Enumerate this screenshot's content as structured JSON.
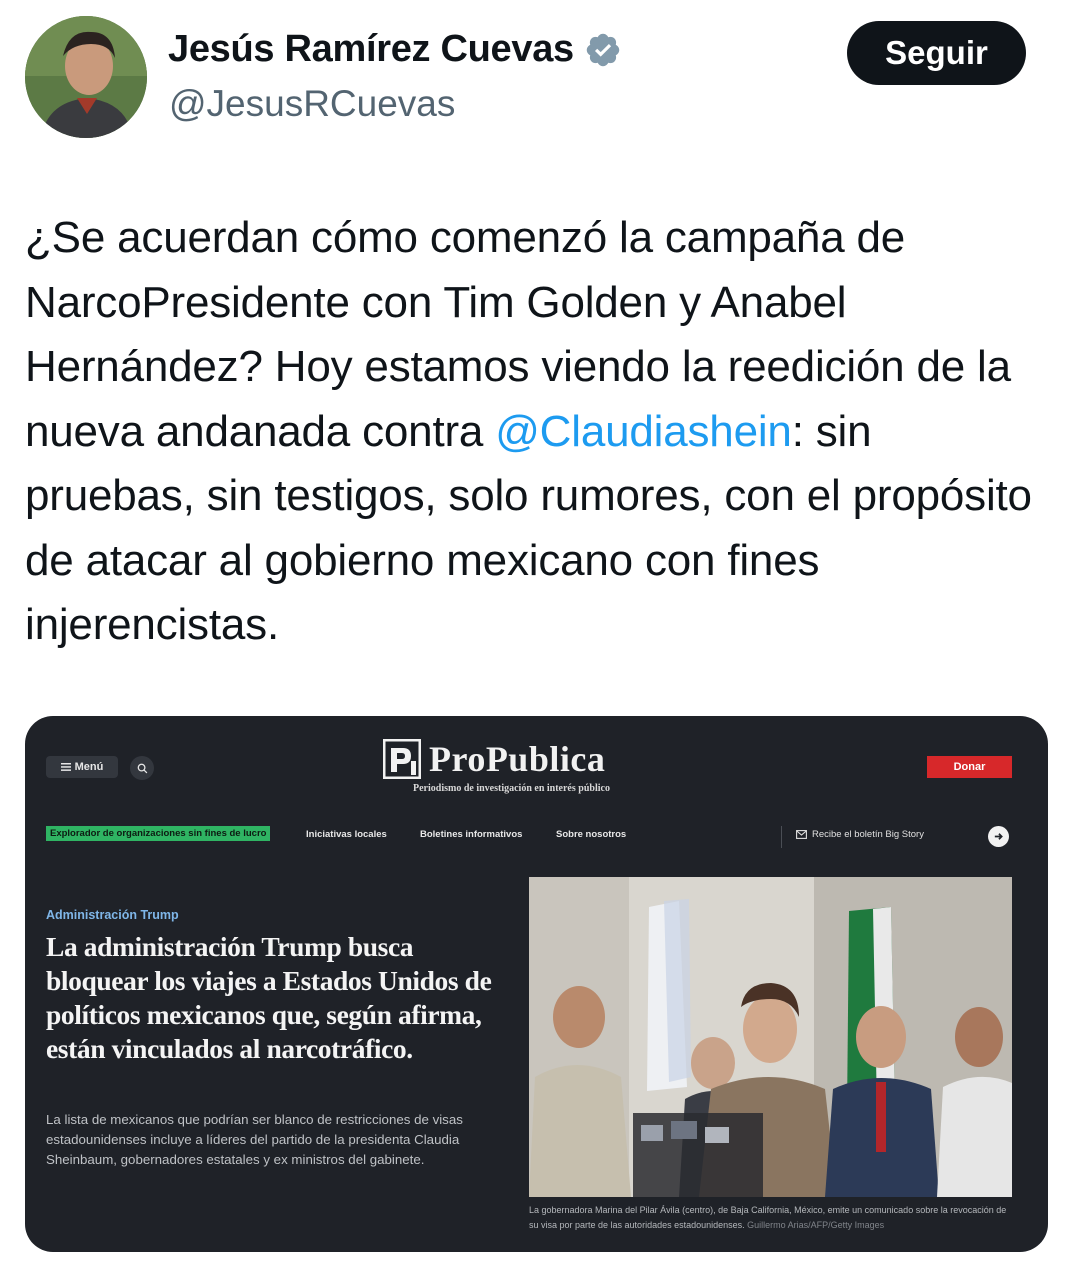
{
  "tweet": {
    "author_name": "Jesús Ramírez Cuevas",
    "handle": "@JesusRCuevas",
    "follow_label": "Seguir",
    "verified_icon": "verified-badge-icon",
    "text_part1": "¿Se acuerdan cómo comenzó la campaña de NarcoPresidente con Tim Golden y Anabel Hernández? Hoy estamos viendo la reedición de la nueva andanada contra ",
    "mention": "@Claudiashein",
    "text_part2": ": sin pruebas, sin testigos, solo rumores, con el propósito de atacar al gobierno mexicano con fines injerencistas.",
    "colors": {
      "text": "#0f1419",
      "secondary": "#536471",
      "link": "#1d9bf0",
      "verified": "#829aab"
    }
  },
  "embedded_page": {
    "menu_label": "Menú",
    "logo_text": "ProPublica",
    "tagline": "Periodismo de investigación en interés público",
    "donate_label": "Donar",
    "nav_items": [
      "Explorador de organizaciones sin fines de lucro",
      "Iniciativas locales",
      "Boletines informativos",
      "Sobre nosotros"
    ],
    "newsletter_label": "Recibe el boletín Big Story",
    "kicker": "Administración Trump",
    "headline": "La administración Trump busca bloquear los viajes a Estados Unidos de políticos mexicanos que, según afirma, están vinculados al narcotráfico.",
    "dek": "La lista de mexicanos que podrían ser blanco de restricciones de visas estadounidenses incluye a líderes del partido de la presidenta Claudia Sheinbaum, gobernadores estatales y ex ministros del gabinete.",
    "caption": "La gobernadora Marina del Pilar Ávila (centro), de Baja California, México, emite un comunicado sobre la revocación de su visa por parte de las autoridades estadounidenses. ",
    "photo_credit": "Guillermo Arias/AFP/Getty Images",
    "colors": {
      "background": "#1f2228",
      "donate": "#d7282a",
      "highlight": "#2fb463",
      "kicker": "#7fb6e8"
    }
  }
}
